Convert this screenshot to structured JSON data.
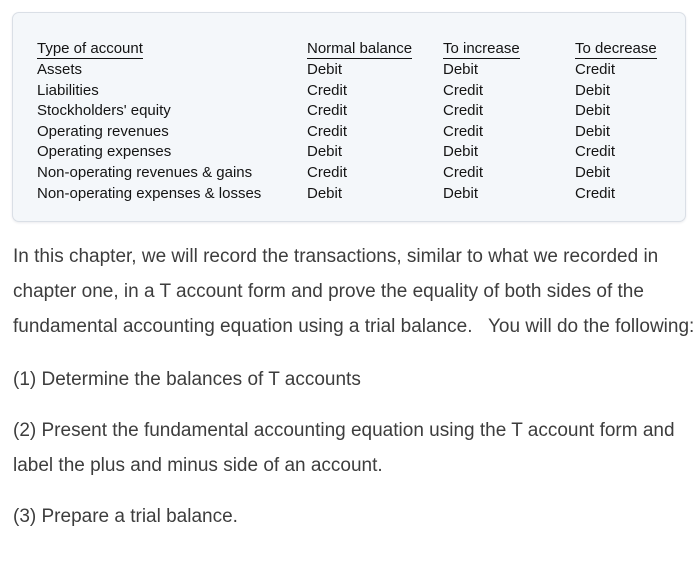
{
  "reference_card": {
    "table": {
      "headers": [
        "Type of account",
        "Normal balance",
        "To increase",
        "To decrease"
      ],
      "rows": [
        {
          "type": "Assets",
          "normal_balance": "Debit",
          "to_increase": "Debit",
          "to_decrease": "Credit"
        },
        {
          "type": "Liabilities",
          "normal_balance": "Credit",
          "to_increase": "Credit",
          "to_decrease": "Debit"
        },
        {
          "type": "Stockholders' equity",
          "normal_balance": "Credit",
          "to_increase": "Credit",
          "to_decrease": "Debit"
        },
        {
          "type": "Operating revenues",
          "normal_balance": "Credit",
          "to_increase": "Credit",
          "to_decrease": "Debit"
        },
        {
          "type": "Operating expenses",
          "normal_balance": "Debit",
          "to_increase": "Debit",
          "to_decrease": "Credit"
        },
        {
          "type": "Non-operating revenues & gains",
          "normal_balance": "Credit",
          "to_increase": "Credit",
          "to_decrease": "Debit"
        },
        {
          "type": "Non-operating expenses & losses",
          "normal_balance": "Debit",
          "to_increase": "Debit",
          "to_decrease": "Credit"
        }
      ]
    }
  },
  "body": {
    "intro": "In this chapter, we will record the transactions, similar to what we recorded in chapter one, in a T account form and prove the equality of both sides of the fundamental accounting equation using a trial balance.   You will do the following:",
    "items": [
      "(1) Determine the balances of T accounts",
      "(2) Present the fundamental accounting equation using the T account form and label the plus and minus side of an account.",
      "(3) Prepare a trial balance."
    ]
  },
  "colors": {
    "card_background": "#f4f7fa",
    "card_border": "#dadfe6",
    "table_text": "#141414",
    "body_text": "#3d3d3d",
    "page_background": "#ffffff"
  }
}
